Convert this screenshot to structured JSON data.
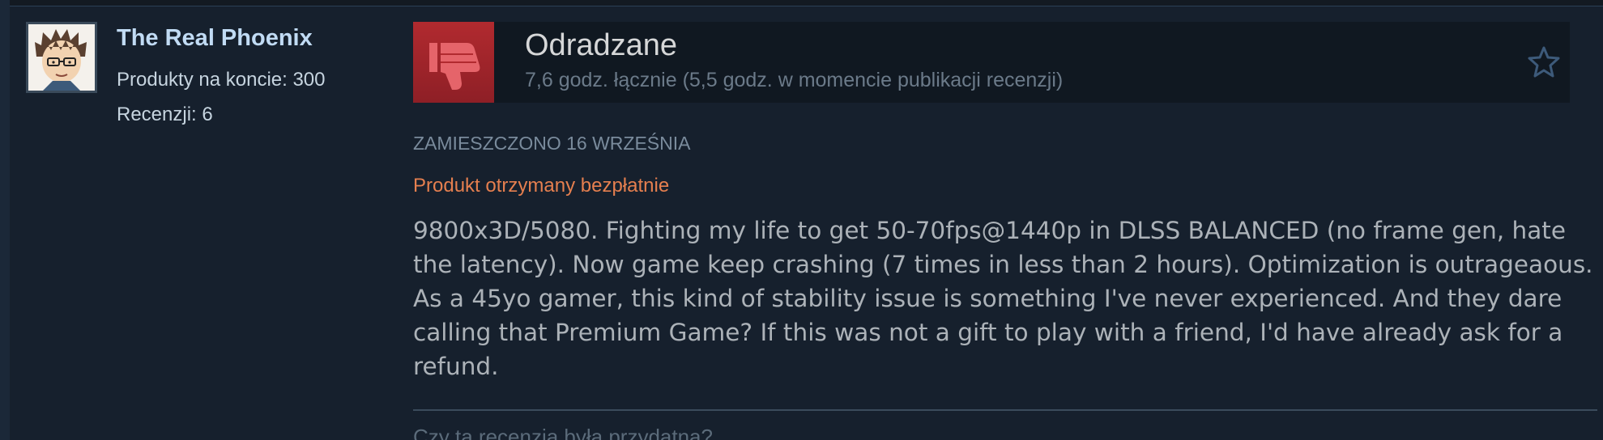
{
  "author": {
    "name": "The Real Phoenix",
    "products": "Produkty na koncie: 300",
    "reviews": "Recenzji: 6",
    "avatar_icon": "cartoon-avatar-icon"
  },
  "review": {
    "verdict": "Odradzane",
    "verdict_icon": "thumbs-down-icon",
    "hours": "7,6 godz. łącznie (5,5 godz. w momencie publikacji recenzji)",
    "posted": "Zamieszczono 16 września",
    "gift_note": "Produkt otrzymany bezpłatnie",
    "body": "9800x3D/5080. Fighting my life to get 50-70fps@1440p in DLSS BALANCED (no frame gen, hate the latency). Now game keep crashing (7 times in less than 2 hours). Optimization is outrageaous. As a 45yo gamer, this kind of stability issue is something I've never experienced. And they dare calling that Premium Game? If this was not a gift to play with a friend, I'd have already ask for a refund.",
    "helpful_prompt": "Czy ta recenzja była przydatna?",
    "award_icon": "star-outline-icon"
  },
  "colors": {
    "background": "#16202d",
    "author_name": "#c1dbf4",
    "negative": "#a2242b",
    "gift": "#e57f4f",
    "body_text": "#acb2b8"
  }
}
